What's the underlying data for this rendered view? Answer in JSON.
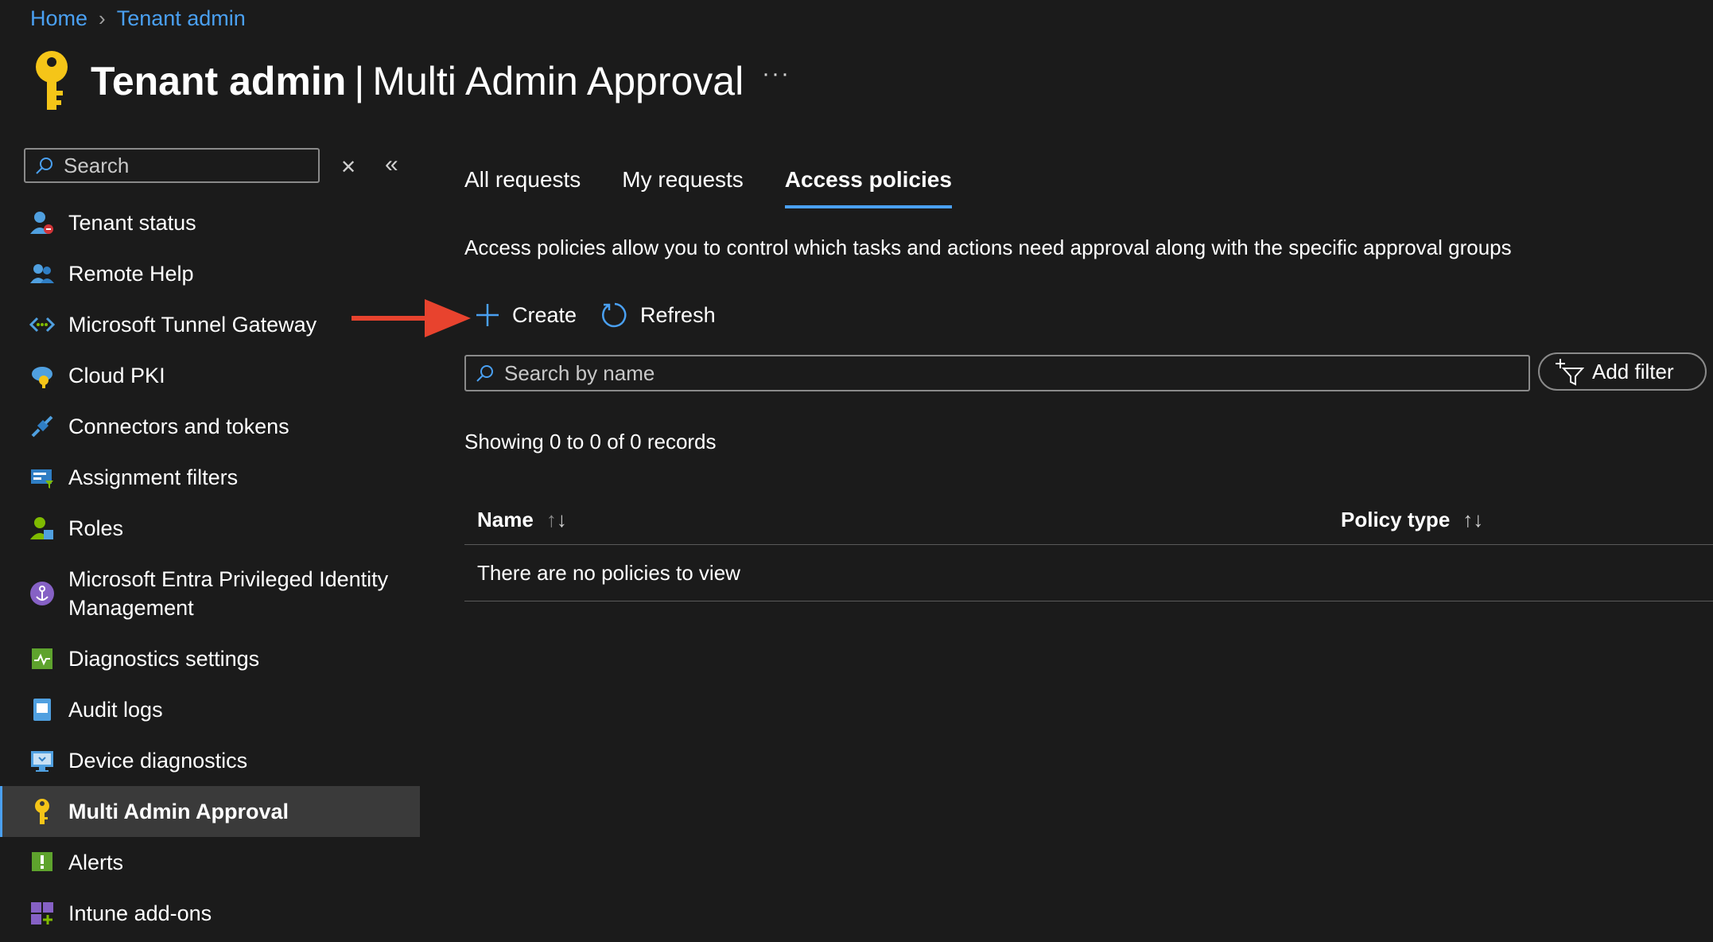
{
  "breadcrumb": {
    "home": "Home",
    "current": "Tenant admin"
  },
  "header": {
    "title_bold": "Tenant admin",
    "separator": "|",
    "title_rest": "Multi Admin Approval",
    "more": "···"
  },
  "sidebar": {
    "search_placeholder": "Search",
    "clear_glyph": "✕",
    "collapse_glyph": "«",
    "items": [
      {
        "label": "Tenant status",
        "icon": "tenant-status-icon"
      },
      {
        "label": "Remote Help",
        "icon": "remote-help-icon"
      },
      {
        "label": "Microsoft Tunnel Gateway",
        "icon": "tunnel-gateway-icon"
      },
      {
        "label": "Cloud PKI",
        "icon": "cloud-pki-icon"
      },
      {
        "label": "Connectors and tokens",
        "icon": "connectors-icon"
      },
      {
        "label": "Assignment filters",
        "icon": "assignment-filters-icon"
      },
      {
        "label": "Roles",
        "icon": "roles-icon"
      },
      {
        "label": "Microsoft Entra Privileged Identity Management",
        "icon": "pim-icon"
      },
      {
        "label": "Diagnostics settings",
        "icon": "diagnostics-icon"
      },
      {
        "label": "Audit logs",
        "icon": "audit-logs-icon"
      },
      {
        "label": "Device diagnostics",
        "icon": "device-diagnostics-icon"
      },
      {
        "label": "Multi Admin Approval",
        "icon": "key-icon",
        "active": true
      },
      {
        "label": "Alerts",
        "icon": "alerts-icon"
      },
      {
        "label": "Intune add-ons",
        "icon": "addons-icon"
      }
    ]
  },
  "tabs": [
    {
      "label": "All requests"
    },
    {
      "label": "My requests"
    },
    {
      "label": "Access policies",
      "active": true
    }
  ],
  "description": "Access policies allow you to control which tasks and actions need approval along with the specific approval groups",
  "toolbar": {
    "create": "Create",
    "refresh": "Refresh"
  },
  "search": {
    "placeholder": "Search by name"
  },
  "filter": {
    "label": "Add filter"
  },
  "records": "Showing 0 to 0 of 0 records",
  "table": {
    "columns": [
      "Name",
      "Policy type"
    ],
    "empty": "There are no policies to view"
  },
  "colors": {
    "accent": "#4aa0f2",
    "background": "#1b1b1b",
    "arrow": "#e8432e",
    "key": "#f5c518"
  }
}
